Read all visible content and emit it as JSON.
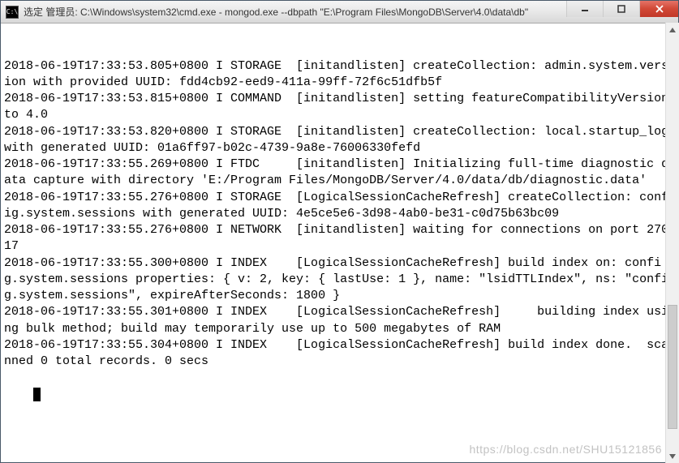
{
  "titlebar": {
    "icon_label": "C:\\",
    "title": "选定 管理员: C:\\Windows\\system32\\cmd.exe - mongod.exe  --dbpath \"E:\\Program Files\\MongoDB\\Server\\4.0\\data\\db\""
  },
  "console_lines": [
    "2018-06-19T17:33:53.805+0800 I STORAGE  [initandlisten] createCollection: admin.system.version with provided UUID: fdd4cb92-eed9-411a-99ff-72f6c51dfb5f",
    "2018-06-19T17:33:53.815+0800 I COMMAND  [initandlisten] setting featureCompatibilityVersion to 4.0",
    "2018-06-19T17:33:53.820+0800 I STORAGE  [initandlisten] createCollection: local.startup_log with generated UUID: 01a6ff97-b02c-4739-9a8e-76006330fefd",
    "2018-06-19T17:33:55.269+0800 I FTDC     [initandlisten] Initializing full-time diagnostic data capture with directory 'E:/Program Files/MongoDB/Server/4.0/data/db/diagnostic.data'",
    "2018-06-19T17:33:55.276+0800 I STORAGE  [LogicalSessionCacheRefresh] createCollection: config.system.sessions with generated UUID: 4e5ce5e6-3d98-4ab0-be31-c0d75b63bc09",
    "2018-06-19T17:33:55.276+0800 I NETWORK  [initandlisten] waiting for connections on port 27017",
    "2018-06-19T17:33:55.300+0800 I INDEX    [LogicalSessionCacheRefresh] build index on: config.system.sessions properties: { v: 2, key: { lastUse: 1 }, name: \"lsidTTLIndex\", ns: \"config.system.sessions\", expireAfterSeconds: 1800 }",
    "2018-06-19T17:33:55.301+0800 I INDEX    [LogicalSessionCacheRefresh]     building index using bulk method; build may temporarily use up to 500 megabytes of RAM",
    "2018-06-19T17:33:55.304+0800 I INDEX    [LogicalSessionCacheRefresh] build index done.  scanned 0 total records. 0 secs",
    ""
  ],
  "watermark": "https://blog.csdn.net/SHU15121856"
}
